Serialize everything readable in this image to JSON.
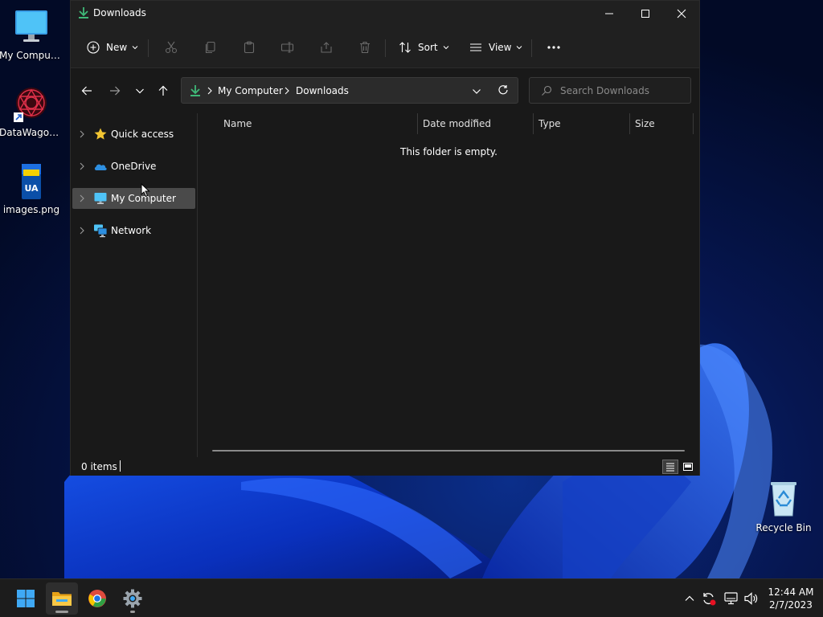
{
  "desktop": {
    "icons": [
      {
        "label": "My Computer"
      },
      {
        "label": "DataWagon..."
      },
      {
        "label": "images.png",
        "badge": "UA"
      },
      {
        "label": "Recycle Bin"
      }
    ]
  },
  "window": {
    "title": "Downloads",
    "commands": {
      "new_label": "New",
      "sort_label": "Sort",
      "view_label": "View"
    },
    "address": {
      "segments": [
        "My Computer",
        "Downloads"
      ]
    },
    "search": {
      "placeholder": "Search Downloads"
    },
    "nav_pane": {
      "items": [
        {
          "label": "Quick access"
        },
        {
          "label": "OneDrive"
        },
        {
          "label": "My Computer"
        },
        {
          "label": "Network"
        }
      ]
    },
    "columns": [
      "Name",
      "Date modified",
      "Type",
      "Size"
    ],
    "empty_message": "This folder is empty.",
    "status": {
      "item_count": "0 items"
    }
  },
  "taskbar": {
    "clock": {
      "time": "12:44 AM",
      "date": "2/7/2023"
    }
  },
  "colors": {
    "accent_green": "#3fb978",
    "onedrive_blue": "#2d8fe0",
    "window_bg": "#191919"
  }
}
